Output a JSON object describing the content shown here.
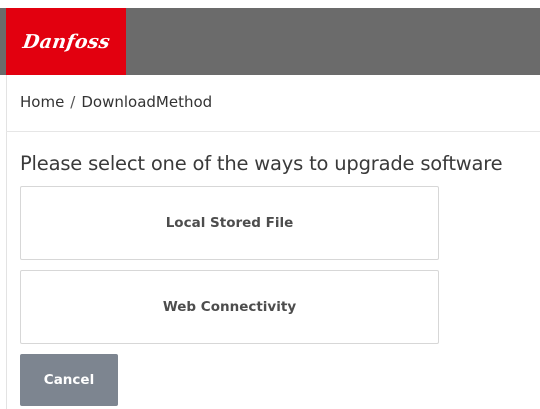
{
  "header": {
    "logo_text": "Danfoss",
    "brand_color": "#e2000f",
    "bar_color": "#6b6b6b"
  },
  "breadcrumb": {
    "home": "Home",
    "separator": "/",
    "current": "DownloadMethod"
  },
  "main": {
    "heading": "Please select one of the ways to upgrade software",
    "options": [
      {
        "label": "Local Stored File"
      },
      {
        "label": "Web Connectivity"
      }
    ],
    "cancel_label": "Cancel",
    "cancel_color": "#7d8590"
  }
}
